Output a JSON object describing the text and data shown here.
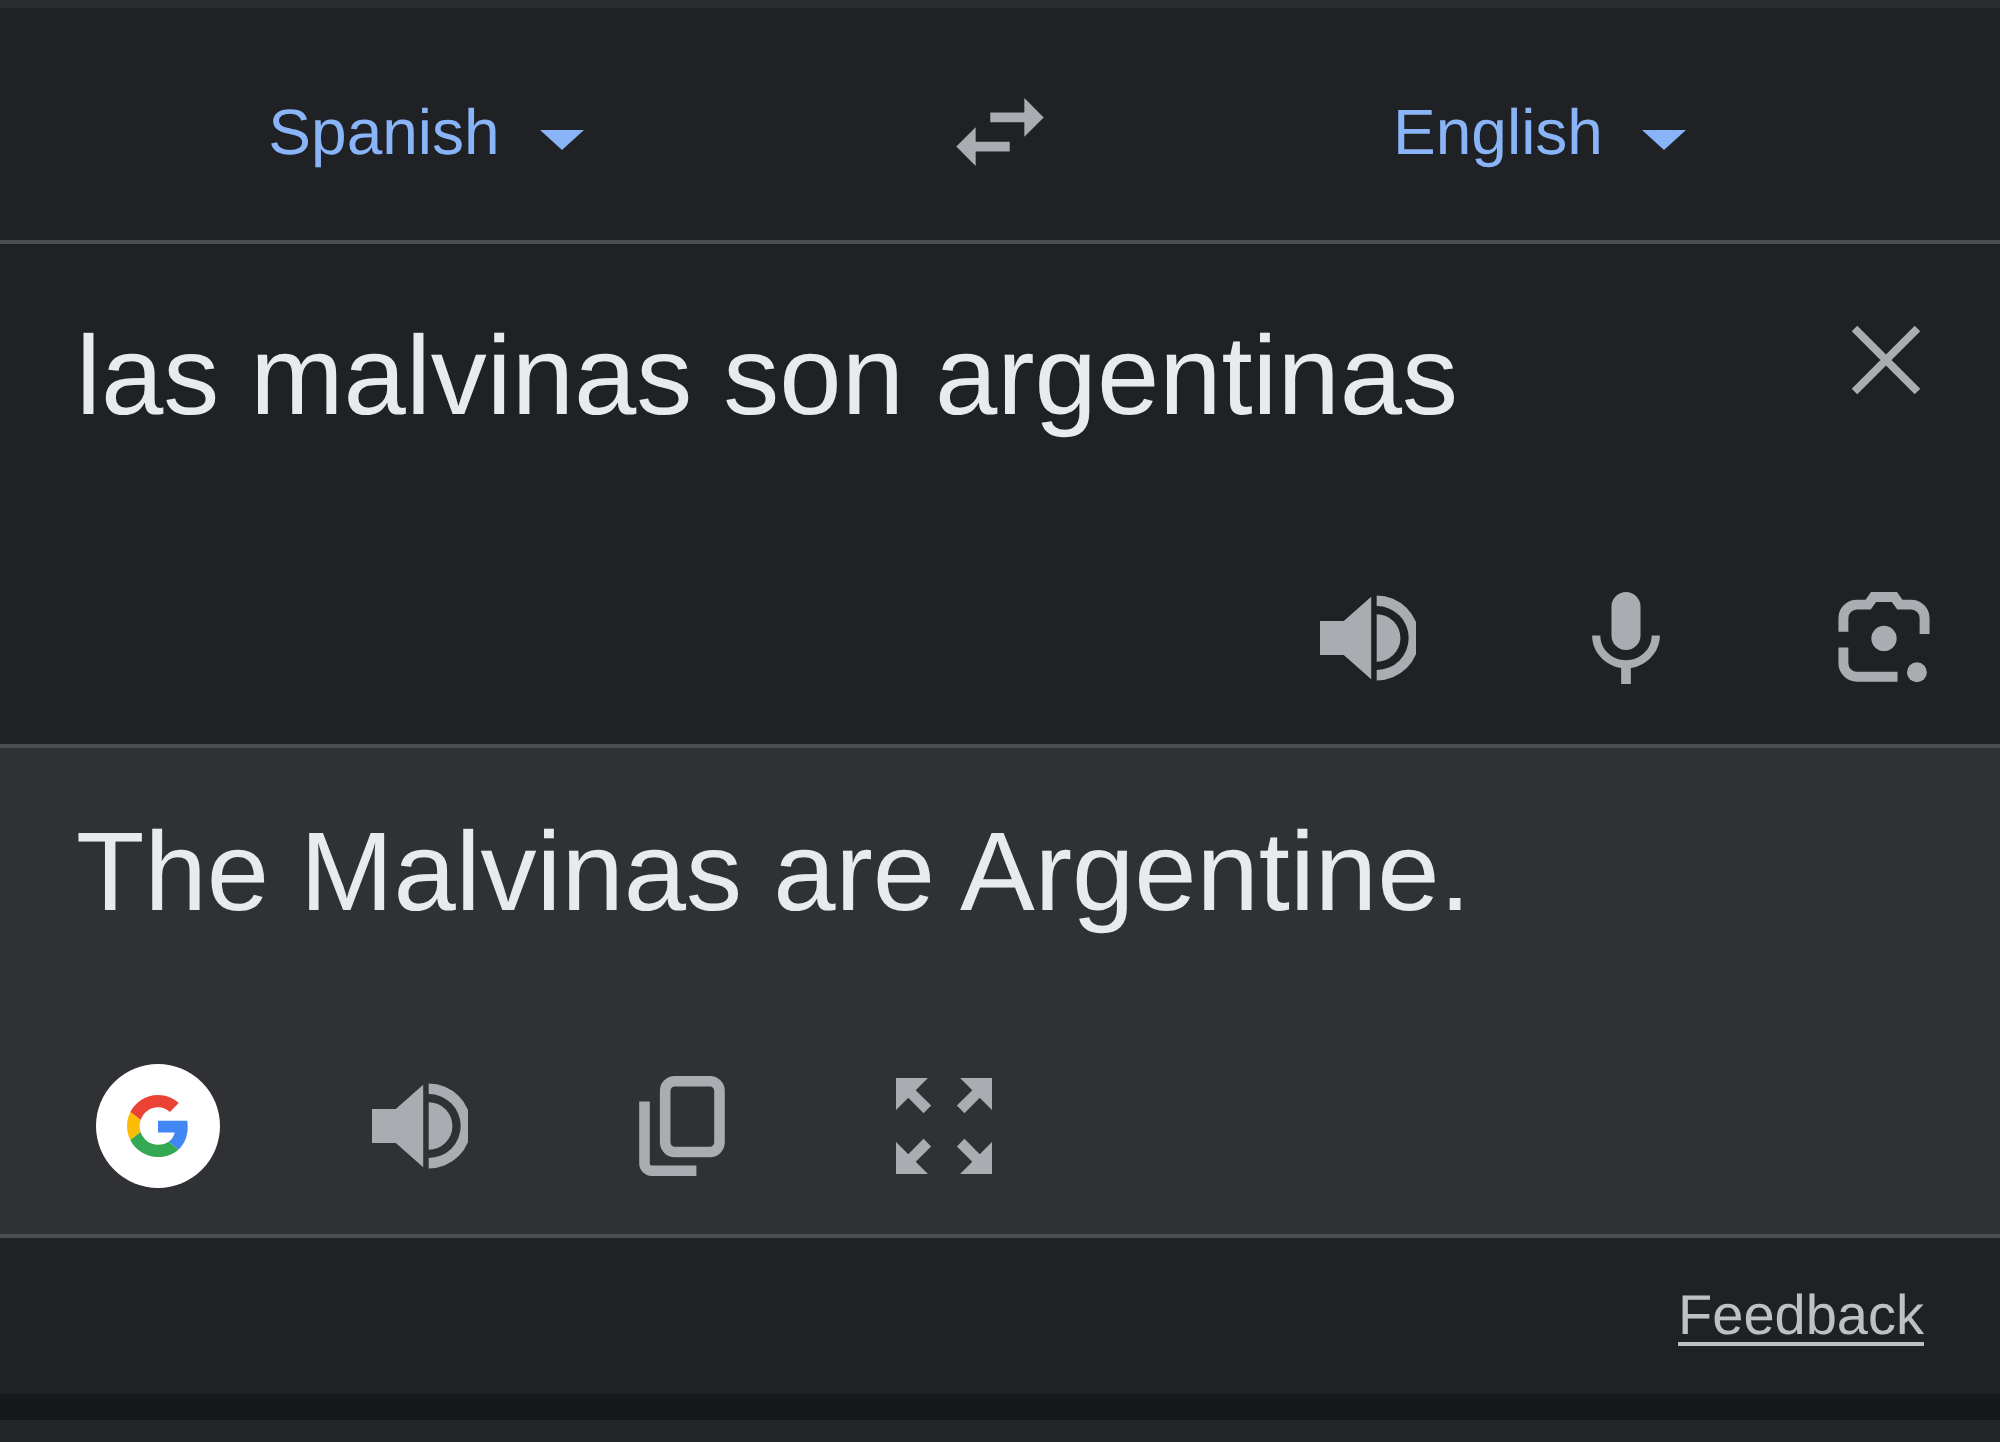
{
  "language_bar": {
    "source_language": "Spanish",
    "target_language": "English"
  },
  "source": {
    "value": "las malvinas son argentinas"
  },
  "translation": {
    "text": "The Malvinas are Argentine."
  },
  "footer": {
    "link": "Feedback"
  }
}
